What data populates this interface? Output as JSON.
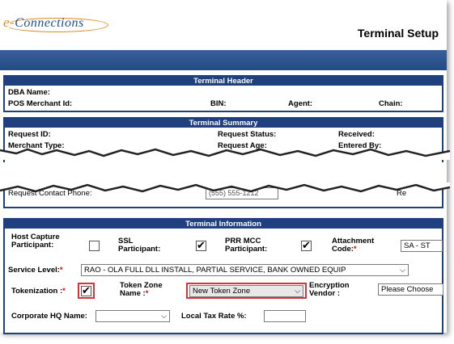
{
  "header": {
    "logo_text_e": "e-",
    "logo_text_rest": "Connections",
    "page_title": "Terminal Setup"
  },
  "terminal_header": {
    "title": "Terminal Header",
    "dba_name_label": "DBA Name:",
    "pos_merchant_id_label": "POS Merchant Id:",
    "bin_label": "BIN:",
    "agent_label": "Agent:",
    "chain_label": "Chain:"
  },
  "terminal_summary": {
    "title": "Terminal Summary",
    "request_id_label": "Request ID:",
    "request_status_label": "Request Status:",
    "received_label": "Received:",
    "merchant_type_label": "Merchant Type:",
    "request_age_label": "Request Age:",
    "entered_by_label": "Entered By:",
    "contact_phone_label": "Request Contact Phone:",
    "contact_phone_value": "(555) 555-1212",
    "partial_right_label": "Re"
  },
  "terminal_info": {
    "title": "Terminal Information",
    "host_capture_label": "Host Capture Participant:",
    "host_capture_checked": false,
    "ssl_label": "SSL Participant:",
    "ssl_checked": true,
    "prr_mcc_label": "PRR MCC Participant:",
    "prr_mcc_checked": true,
    "attachment_code_label": "Attachment Code:",
    "attachment_code_value": "SA - ST",
    "service_level_label": "Service Level:",
    "service_level_value": "RAO - OLA FULL DLL INSTALL, PARTIAL SERVICE, BANK OWNED EQUIP",
    "tokenization_label": "Tokenization :",
    "tokenization_checked": true,
    "token_zone_label": "Token Zone Name :",
    "token_zone_value": "New Token Zone",
    "encryption_vendor_label": "Encryption Vendor :",
    "encryption_vendor_value": "Please Choose",
    "corporate_hq_label": "Corporate HQ Name:",
    "corporate_hq_value": "",
    "local_tax_label": "Local Tax Rate %:",
    "local_tax_value": "",
    "required_mark": "*"
  }
}
